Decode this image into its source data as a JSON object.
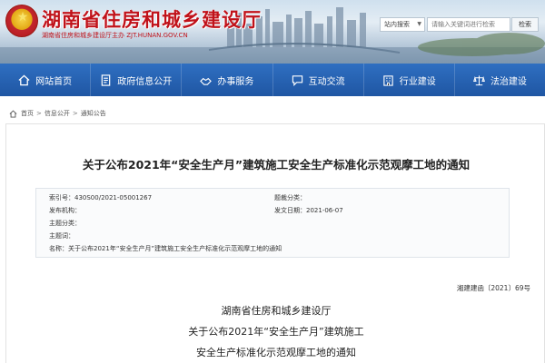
{
  "header": {
    "site_title": "湖南省住房和城乡建设厅",
    "site_subtitle": "湖南省住房和城乡建设厅主办   ZJT.HUNAN.GOV.CN",
    "search_scope": "站内搜索",
    "search_placeholder": "请输入关键词进行检索",
    "search_button": "检索"
  },
  "nav": {
    "items": [
      {
        "label": "网站首页",
        "icon": "home-icon"
      },
      {
        "label": "政府信息公开",
        "icon": "document-icon"
      },
      {
        "label": "办事服务",
        "icon": "handshake-icon"
      },
      {
        "label": "互动交流",
        "icon": "chat-icon"
      },
      {
        "label": "行业建设",
        "icon": "building-icon"
      },
      {
        "label": "法治建设",
        "icon": "law-icon"
      }
    ]
  },
  "breadcrumb": {
    "items": [
      "首页",
      "信息公开",
      "通知公告"
    ],
    "separator": ">"
  },
  "article": {
    "title": "关于公布2021年“安全生产月”建筑施工安全生产标准化示范观摩工地的通知",
    "meta": {
      "index_label": "索引号：",
      "index_value": "430S00/2021-05001267",
      "subject_label": "题裁分类：",
      "subject_value": "",
      "publisher_label": "发布机构：",
      "publisher_value": "",
      "date_label": "发文日期：",
      "date_value": "2021-06-07",
      "topic_label": "主题分类：",
      "topic_value": "",
      "keywords_label": "主题词：",
      "keywords_value": "",
      "name_label": "名称：",
      "name_value": "关于公布2021年“安全生产月”建筑施工安全生产标准化示范观摩工地的通知"
    },
    "doc_number": "湘建建函〔2021〕69号",
    "body_lines": [
      "湖南省住房和城乡建设厅",
      "关于公布2021年“安全生产月”建筑施工",
      "安全生产标准化示范观摩工地的通知"
    ]
  },
  "colors": {
    "brand_red": "#c0121a",
    "nav_blue": "#1f56a3"
  }
}
